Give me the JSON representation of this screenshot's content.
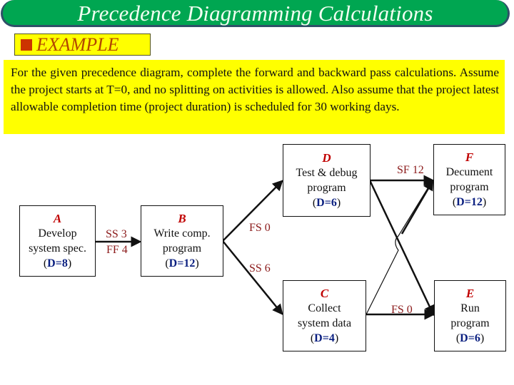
{
  "header": {
    "title": "Precedence Diagramming Calculations"
  },
  "section": {
    "label": "EXAMPLE"
  },
  "problem": {
    "text": "For the given precedence diagram, complete the forward and backward pass calculations. Assume the project starts at T=0, and no splitting on activities is allowed. Also assume that the project latest allowable completion time (project duration) is scheduled for 30 working days."
  },
  "colors": {
    "title_bar": "#00a651",
    "title_border": "#2f5068",
    "highlight": "#ffff00",
    "activity_letter": "#c00000",
    "relation_label": "#8b1a1a",
    "duration": "#0a1f80"
  },
  "activities": [
    {
      "id": "A",
      "desc_line1": "Develop",
      "desc_line2": "system spec.",
      "duration_label": "D=8"
    },
    {
      "id": "B",
      "desc_line1": "Write comp.",
      "desc_line2": "program",
      "duration_label": "D=12"
    },
    {
      "id": "C",
      "desc_line1": "Collect",
      "desc_line2": "system data",
      "duration_label": "D=4"
    },
    {
      "id": "D",
      "desc_line1": "Test & debug",
      "desc_line2": "program",
      "duration_label": "D=6"
    },
    {
      "id": "E",
      "desc_line1": "Run",
      "desc_line2": "program",
      "duration_label": "D=6"
    },
    {
      "id": "F",
      "desc_line1": "Decument",
      "desc_line2": "program",
      "duration_label": "D=12"
    }
  ],
  "relationships": [
    {
      "from": "A",
      "to": "B",
      "labels": [
        "SS 3",
        "FF 4"
      ]
    },
    {
      "from": "B",
      "to": "D",
      "labels": [
        "FS 0"
      ]
    },
    {
      "from": "B",
      "to": "C",
      "labels": [
        "SS 6"
      ]
    },
    {
      "from": "D",
      "to": "F",
      "labels": [
        "SF 12"
      ]
    },
    {
      "from": "D",
      "to": "E",
      "labels": []
    },
    {
      "from": "C",
      "to": "F",
      "labels": []
    },
    {
      "from": "C",
      "to": "E",
      "labels": [
        "FS 0"
      ]
    }
  ],
  "project": {
    "start_time": "T=0",
    "duration_days": 30
  }
}
